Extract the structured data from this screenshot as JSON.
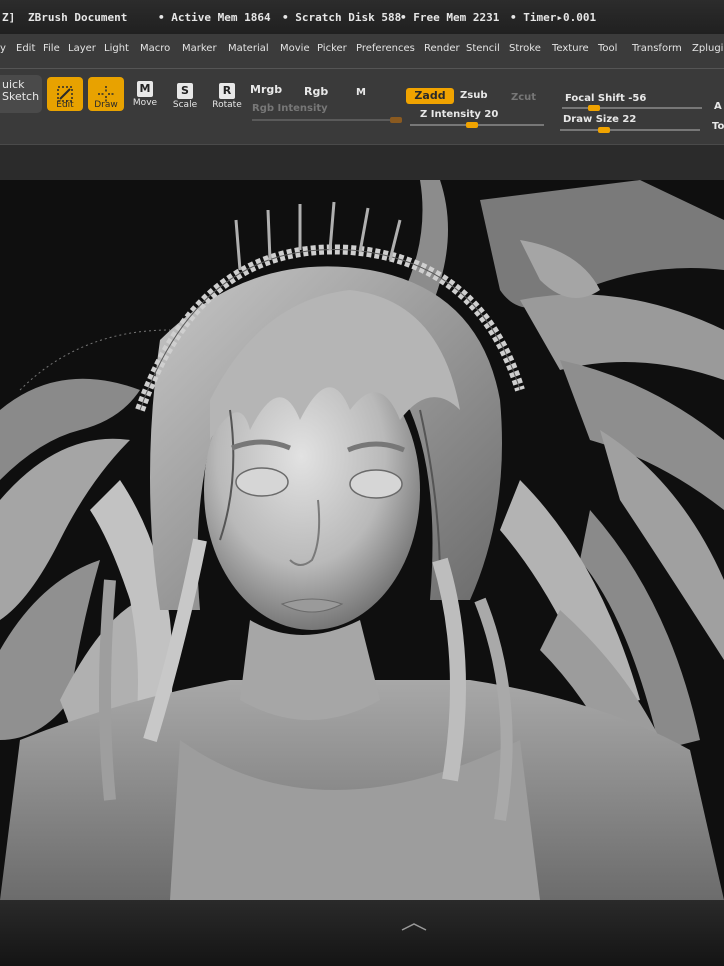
{
  "titlebar": {
    "app_icon": "Z]",
    "title": "ZBrush Document",
    "active_mem": "• Active Mem 1864",
    "scratch_disk": "• Scratch Disk 588",
    "free_mem": "• Free Mem 2231",
    "timer": "• Timer▸0.001"
  },
  "menu": {
    "items": [
      "y",
      "Edit",
      "File",
      "Layer",
      "Light",
      "Macro",
      "Marker",
      "Material",
      "Movie",
      "Picker",
      "Preferences",
      "Render",
      "Stencil",
      "Stroke",
      "Texture",
      "Tool",
      "Transform",
      "Zplugin"
    ]
  },
  "shelf": {
    "quick_sketch": "uick\nSketch",
    "edit": "Edit",
    "draw": "Draw",
    "move": "Move",
    "scale": "Scale",
    "rotate": "Rotate",
    "move_icon": "M",
    "scale_icon": "S",
    "rotate_icon": "R",
    "mrgb": "Mrgb",
    "rgb": "Rgb",
    "m": "M",
    "rgb_intensity": "Rgb Intensity",
    "zadd": "Zadd",
    "zsub": "Zsub",
    "zcut": "Zcut",
    "z_intensity": "Z Intensity 20",
    "focal_shift": "Focal Shift -56",
    "draw_size": "Draw Size 22",
    "right_a": "A",
    "right_to": "To"
  },
  "colors": {
    "accent": "#f0a300",
    "panel": "#3a3a3a",
    "canvas": "#0f0f0f"
  },
  "icons": [
    "edit-icon",
    "draw-icon",
    "move-icon",
    "scale-icon",
    "rotate-icon"
  ]
}
